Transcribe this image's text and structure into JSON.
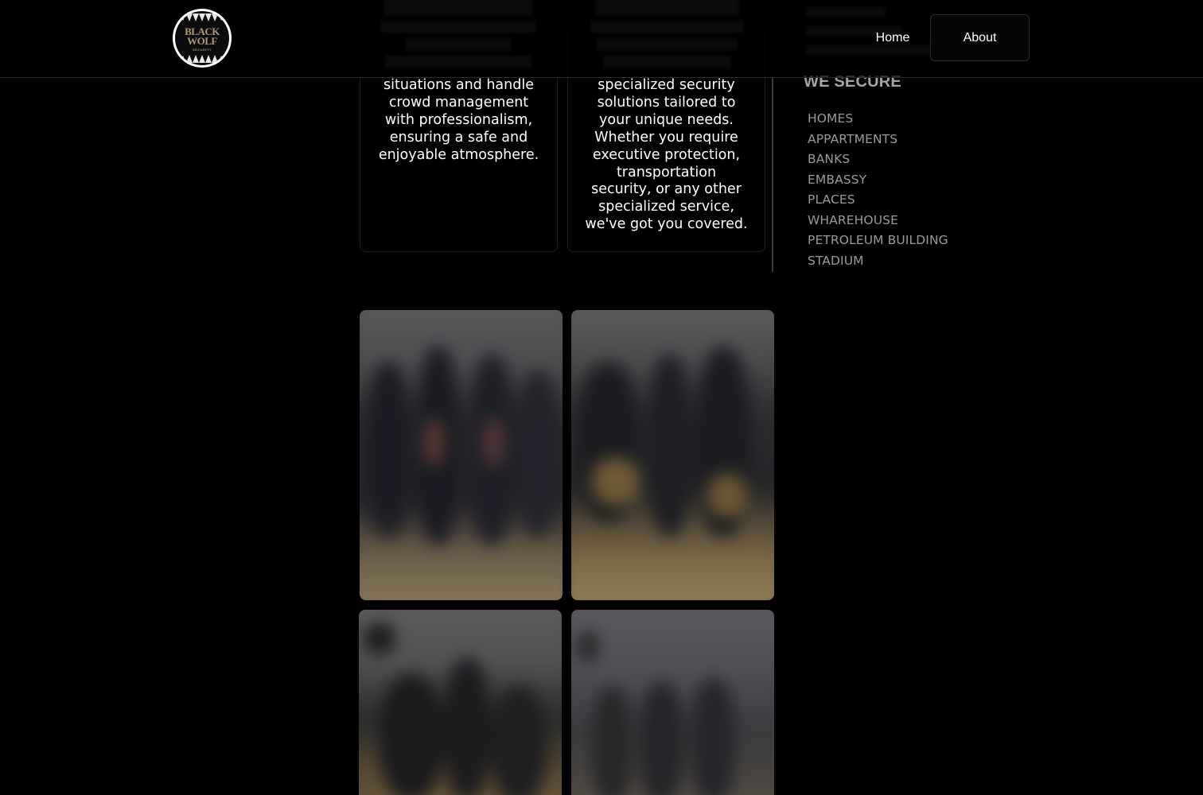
{
  "header": {
    "logo": {
      "alt": "Black Wolf Security logo",
      "line1": "BLACK",
      "line2": "WOLF",
      "sub": "SECURITY"
    },
    "nav": {
      "home_label": "Home",
      "about_label": "About"
    }
  },
  "services": {
    "cards": [
      {
        "text": "situations and handle\ncrowd management\nwith professionalism,\nensuring a safe and\nenjoyable atmosphere."
      },
      {
        "text": "specialized security\nsolutions tailored to\nyour unique needs.\nWhether you require\nexecutive protection,\ntransportation\nsecurity, or any other\nspecialized service,\nwe've got you covered."
      }
    ]
  },
  "we_secure": {
    "title": "WE SECURE",
    "items": [
      "HOMES",
      "APPARTMENTS",
      "BANKS",
      "EMBASSY",
      "PLACES",
      "WHAREHOUSE",
      "PETROLEUM BUILDING",
      "STADIUM"
    ]
  },
  "gallery": {
    "photos": [
      {
        "name": "security-team-photo-1",
        "sky": "#5a5c5e",
        "ground": "#7a6a52"
      },
      {
        "name": "security-team-photo-2",
        "sky": "#5d5f61",
        "ground": "#8a7450"
      },
      {
        "name": "security-team-photo-3",
        "sky": "#5c5e60",
        "ground": "#6e5a3c"
      },
      {
        "name": "security-team-photo-4",
        "sky": "#5a5c5f",
        "ground": "#5c5248"
      }
    ]
  },
  "colors": {
    "background": "#000000",
    "header_border": "#2a2a2a",
    "body_text": "#ffffff",
    "secure_title": "#a6a6a6",
    "secure_items": "#9a9a9a"
  }
}
